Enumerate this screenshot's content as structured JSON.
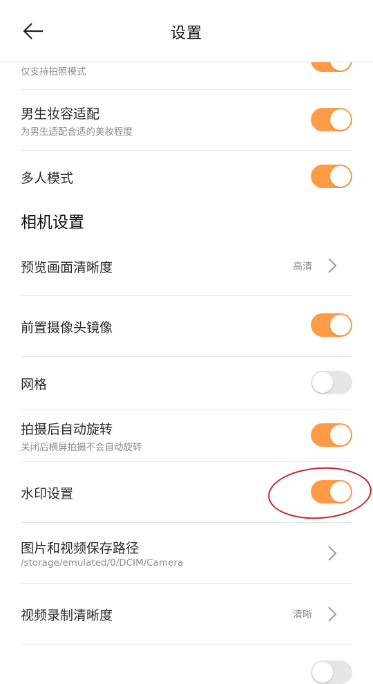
{
  "header": {
    "title": "设置"
  },
  "rows": {
    "photo_only": {
      "subtitle": "仅支持拍照模式",
      "on": true
    },
    "male_makeup": {
      "title": "男生妆容适配",
      "subtitle": "为男生适配合适的美妆程度",
      "on": true
    },
    "multi_person": {
      "title": "多人模式",
      "on": true
    },
    "section_camera": "相机设置",
    "preview_quality": {
      "title": "预览画面清晰度",
      "value": "高清"
    },
    "front_mirror": {
      "title": "前置摄像头镜像",
      "on": true
    },
    "grid": {
      "title": "网格",
      "on": false
    },
    "auto_rotate": {
      "title": "拍摄后自动旋转",
      "subtitle": "关闭后横屏拍摄不会自动旋转",
      "on": true
    },
    "watermark": {
      "title": "水印设置",
      "on": true
    },
    "save_path": {
      "title": "图片和视频保存路径",
      "subtitle": "/storage/emulated/0/DCIM/Camera"
    },
    "video_quality": {
      "title": "视频录制清晰度",
      "value": "清晰"
    }
  },
  "colors": {
    "accent": "#ff9a45",
    "toggle_off": "#e6e6e6",
    "annotation": "#c8202a"
  }
}
